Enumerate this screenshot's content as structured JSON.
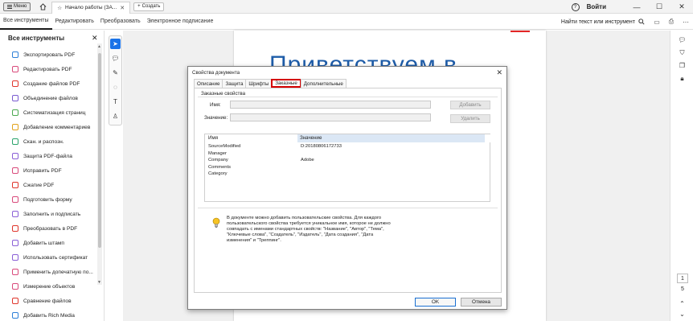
{
  "titlebar": {
    "menu_label": "Меню",
    "tab_title": "Начало работы (ЗА...",
    "create_label": "Создать",
    "signin_label": "Войти"
  },
  "toolbar": {
    "tabs": [
      "Все инструменты",
      "Редактировать",
      "Преобразовать",
      "Электронное подписание"
    ],
    "find_label": "Найти текст или инструмент"
  },
  "left_panel": {
    "title": "Все инструменты",
    "items": [
      {
        "label": "Экспортировать PDF",
        "color": "#2d7fd8"
      },
      {
        "label": "Редактировать PDF",
        "color": "#d94a7b"
      },
      {
        "label": "Создание файлов PDF",
        "color": "#e0352b"
      },
      {
        "label": "Объединение файлов",
        "color": "#7a5bd1"
      },
      {
        "label": "Систематизация страниц",
        "color": "#4aa84f"
      },
      {
        "label": "Добавление комментариев",
        "color": "#e2a21b"
      },
      {
        "label": "Скан. и распозн.",
        "color": "#2aa36b"
      },
      {
        "label": "Защита PDF-файла",
        "color": "#8a5fd6"
      },
      {
        "label": "Исправить PDF",
        "color": "#d94a7b"
      },
      {
        "label": "Сжатие PDF",
        "color": "#e0352b"
      },
      {
        "label": "Подготовить форму",
        "color": "#d94a7b"
      },
      {
        "label": "Заполнить и подписать",
        "color": "#8a5fd6"
      },
      {
        "label": "Преобразовать в PDF",
        "color": "#e0352b"
      },
      {
        "label": "Добавить штамп",
        "color": "#8a5fd6"
      },
      {
        "label": "Использовать сертификат",
        "color": "#8a5fd6"
      },
      {
        "label": "Применить допечатную по...",
        "color": "#d94a7b"
      },
      {
        "label": "Измерение объектов",
        "color": "#d94a7b"
      },
      {
        "label": "Сравнение файлов",
        "color": "#e0352b"
      },
      {
        "label": "Добавить Rich Media",
        "color": "#2d7fd8"
      }
    ]
  },
  "document": {
    "heading": "Приветствуем в"
  },
  "right_rail": {
    "page_current": "1",
    "page_total": "5"
  },
  "dialog": {
    "title": "Свойства документа",
    "tabs": [
      "Описание",
      "Защита",
      "Шрифты",
      "Заказные",
      "Дополнительные"
    ],
    "active_tab": "Заказные",
    "group_title": "Заказные свойства",
    "name_label": "Имя:",
    "value_label": "Значение:",
    "name_value": "",
    "value_value": "",
    "add_label": "Добавить",
    "delete_label": "Удалить",
    "table": {
      "col_name": "Имя",
      "col_value": "Значение",
      "rows": [
        {
          "name": "SourceModified",
          "value": "D:20180806172733"
        },
        {
          "name": "Manager",
          "value": ""
        },
        {
          "name": "Company",
          "value": "Adobe"
        },
        {
          "name": "Comments",
          "value": ""
        },
        {
          "name": "Category",
          "value": ""
        }
      ]
    },
    "info_text": "В документе можно добавить пользовательские свойства. Для каждого пользовательского свойства требуется уникальное имя, которое не должно совпадать с именами стандартных свойств: \"Название\", \"Автор\", \"Тема\", \"Ключевые слова\", \"Создатель\", \"Издатель\", \"Дата создания\", \"Дата изменения\" и \"Треппинг\".",
    "ok_label": "OK",
    "cancel_label": "Отмена"
  }
}
